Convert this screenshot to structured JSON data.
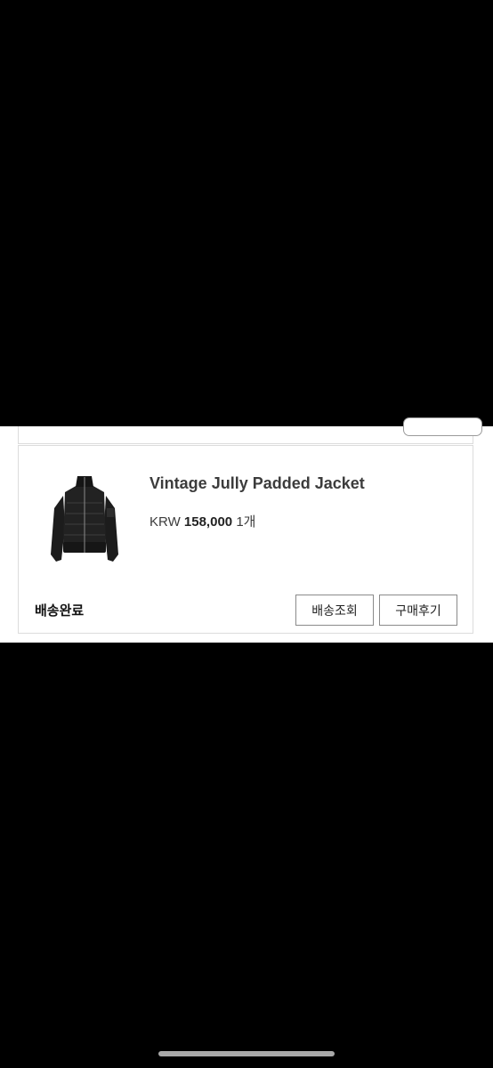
{
  "order": {
    "product_name": "Vintage Jully Padded Jacket",
    "currency": "KRW",
    "price": "158,000",
    "quantity": "1개",
    "status": "배송완료",
    "track_button_label": "배송조회",
    "review_button_label": "구매후기",
    "thumbnail_icon": "cropped-padded-jacket-image"
  },
  "colors": {
    "background": "#000000",
    "panel": "#ffffff",
    "text": "#3c3c3c"
  }
}
